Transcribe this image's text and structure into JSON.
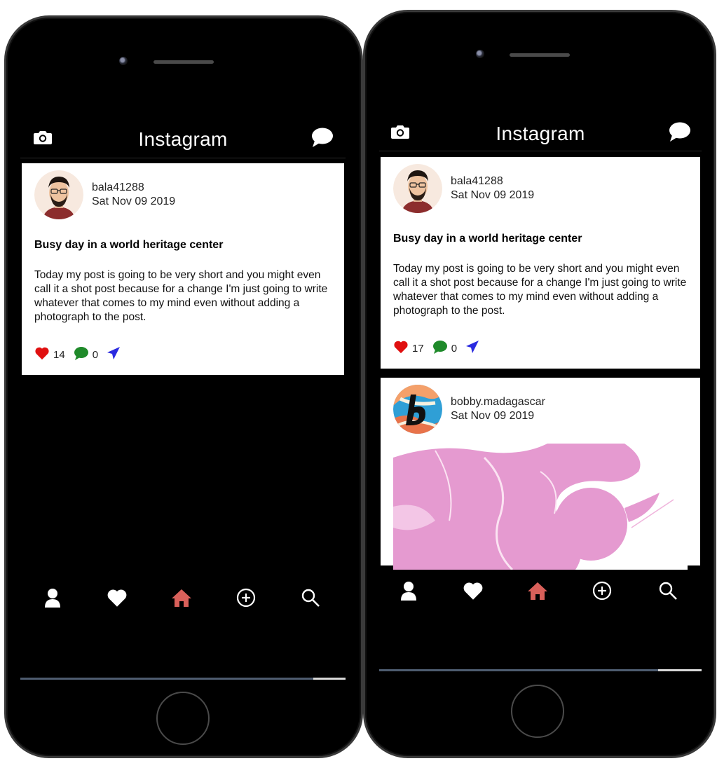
{
  "screens": [
    {
      "header": {
        "title": "Instagram",
        "left_icon": "camera-icon",
        "right_icon": "chat-bubble-icon"
      },
      "posts": [
        {
          "author": "bala41288",
          "date": "Sat Nov 09 2019",
          "avatar_icon": "bearded-man-avatar",
          "title": "Busy day in a world heritage center",
          "body": "Today my post is going to be very short and you might even call it a shot post because for a change I'm just going to write whatever that comes to my mind even without adding a photograph to the post.",
          "likes": "14",
          "comments": "0",
          "share_icon": "send-icon"
        }
      ],
      "tabs": [
        "profile-icon",
        "heart-icon",
        "home-icon",
        "add-circle-icon",
        "search-icon"
      ],
      "active_tab": "home-icon"
    },
    {
      "header": {
        "title": "Instagram",
        "left_icon": "camera-icon",
        "right_icon": "chat-bubble-icon"
      },
      "posts": [
        {
          "author": "bala41288",
          "date": "Sat Nov 09 2019",
          "avatar_icon": "bearded-man-avatar",
          "title": "Busy day in a world heritage center",
          "body": "Today my post is going to be very short and you might even call it a shot post because for a change I'm just going to write whatever that comes to my mind even without adding a photograph to the post.",
          "likes": "17",
          "comments": "0",
          "share_icon": "send-icon"
        },
        {
          "author": "bobby.madagascar",
          "date": "Sat Nov 09 2019",
          "avatar_icon": "letter-b-logo-avatar",
          "image": "pink-abstract-flower-image"
        }
      ],
      "tabs": [
        "profile-icon",
        "heart-icon",
        "home-icon",
        "add-circle-icon",
        "search-icon"
      ],
      "active_tab": "home-icon"
    }
  ],
  "colors": {
    "background": "#000000",
    "card": "#ffffff",
    "like": "#e01010",
    "comment": "#1f8a2a",
    "share": "#2a2ae0",
    "active_tab": "#d9605a",
    "inactive_tab": "#ffffff",
    "image_pink": "#e59ad0"
  }
}
